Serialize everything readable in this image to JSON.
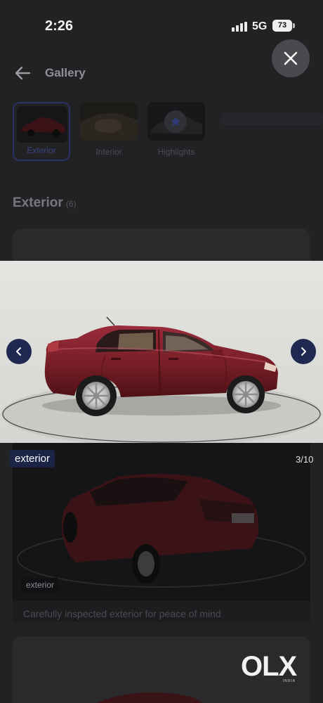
{
  "status_bar": {
    "time": "2:26",
    "network": "5G",
    "battery": "73"
  },
  "header": {
    "title": "Gallery",
    "back_icon": "arrow-left-icon"
  },
  "tabs": [
    {
      "label": "Exterior",
      "active": true
    },
    {
      "label": "Interior",
      "active": false
    },
    {
      "label": "Highlights",
      "active": false
    }
  ],
  "section": {
    "title": "Exterior",
    "count": "(6)"
  },
  "card": {
    "tag": "exterior",
    "caption": "Carefully inspected exterior for peace of mind"
  },
  "viewer": {
    "close_icon": "close-icon",
    "tag": "exterior",
    "counter": "3/10",
    "prev_icon": "chevron-left-icon",
    "next_icon": "chevron-right-icon"
  },
  "logo": {
    "text": "OLX",
    "sub": "INDIA"
  },
  "colors": {
    "accent": "#1e2850",
    "car": "#7a1f27",
    "overlay": "#222224"
  }
}
